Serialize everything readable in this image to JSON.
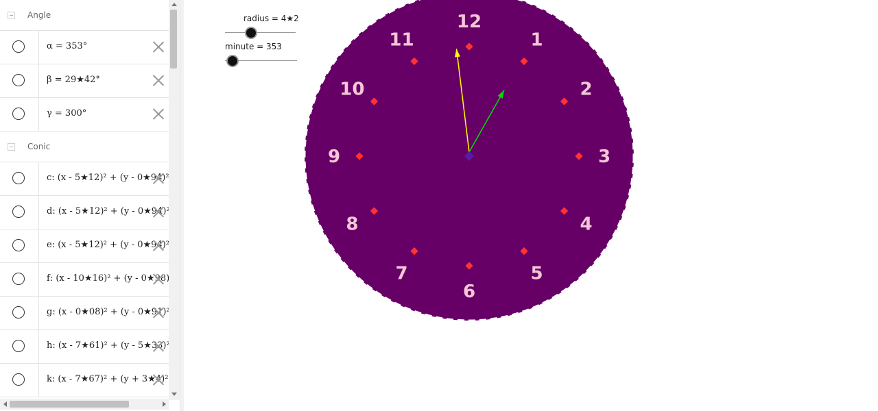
{
  "algebra": {
    "groups": [
      {
        "label": "Angle"
      },
      {
        "label": "Conic"
      }
    ],
    "angle_rows": [
      {
        "text": "α = 353°"
      },
      {
        "text": "β = 29★42°"
      },
      {
        "text": "γ = 300°"
      }
    ],
    "conic_rows": [
      {
        "text": "c: (x - 5★12)² + (y - 0★94)²"
      },
      {
        "text": "d: (x - 5★12)² + (y - 0★94)²"
      },
      {
        "text": "e: (x - 5★12)² + (y - 0★94)²"
      },
      {
        "text": "f: (x - 10★16)² + (y - 0★98)"
      },
      {
        "text": "g: (x - 0★08)² + (y - 0★91)²"
      },
      {
        "text": "h: (x - 7★61)² + (y - 5★33)²"
      },
      {
        "text": "k: (x - 7★67)² + (y + 3★4)²"
      }
    ]
  },
  "sliders": {
    "radius": {
      "label": "radius = 4★2",
      "fraction": 0.37
    },
    "minute": {
      "label": "minute = 353",
      "fraction": 0.1
    }
  },
  "clock": {
    "numbers": [
      "12",
      "1",
      "2",
      "3",
      "4",
      "5",
      "6",
      "7",
      "8",
      "9",
      "10",
      "11"
    ],
    "face_color": "#660066",
    "number_color": "#f4c6d8",
    "dot_color": "#ff3333",
    "hour_hand_color": "#00dd00",
    "minute_hand_color": "#ffff00",
    "minute_value": 353,
    "hour_hand_angle_deg": 29.42
  }
}
